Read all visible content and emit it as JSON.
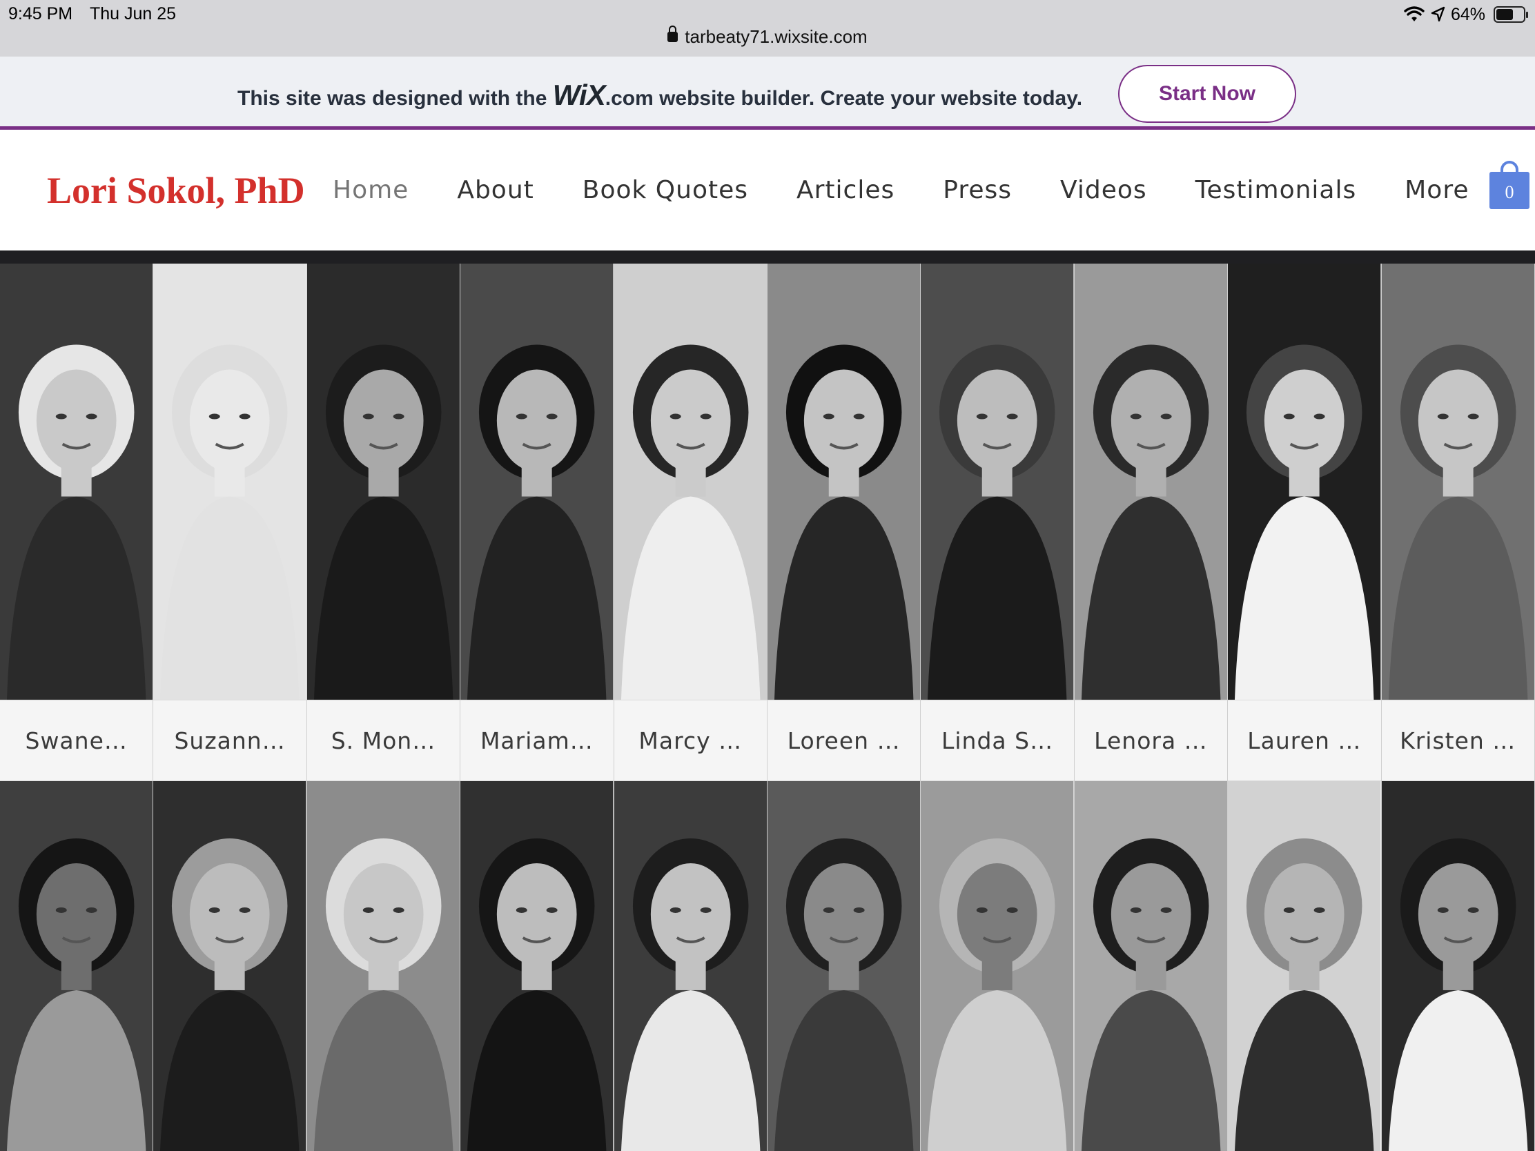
{
  "status_bar": {
    "time": "9:45 PM",
    "date": "Thu Jun 25",
    "battery": "64%",
    "battery_level": 0.64
  },
  "address_bar": {
    "url": "tarbeaty71.wixsite.com"
  },
  "wix_banner": {
    "text_before": "This site was designed with the ",
    "logo": "WiX",
    "text_after": ".com website builder. Create your website today.",
    "button_label": "Start Now"
  },
  "site": {
    "logo": "Lori Sokol, PhD",
    "nav": [
      "Home",
      "About",
      "Book Quotes",
      "Articles",
      "Press",
      "Videos",
      "Testimonials",
      "More"
    ],
    "active_nav": "Home",
    "cart_count": "0",
    "cart_color": "#5d83de",
    "logo_color": "#d3302c",
    "accent_color": "#7a2f86"
  },
  "gallery": {
    "row1": [
      {
        "caption": "Swane…"
      },
      {
        "caption": "Suzann…"
      },
      {
        "caption": "S. Mon…"
      },
      {
        "caption": "Mariam…"
      },
      {
        "caption": "Marcy …"
      },
      {
        "caption": "Loreen …"
      },
      {
        "caption": "Linda S…"
      },
      {
        "caption": "Lenora …"
      },
      {
        "caption": "Lauren …"
      },
      {
        "caption": "Kristen …"
      }
    ],
    "row2_count": 10
  }
}
